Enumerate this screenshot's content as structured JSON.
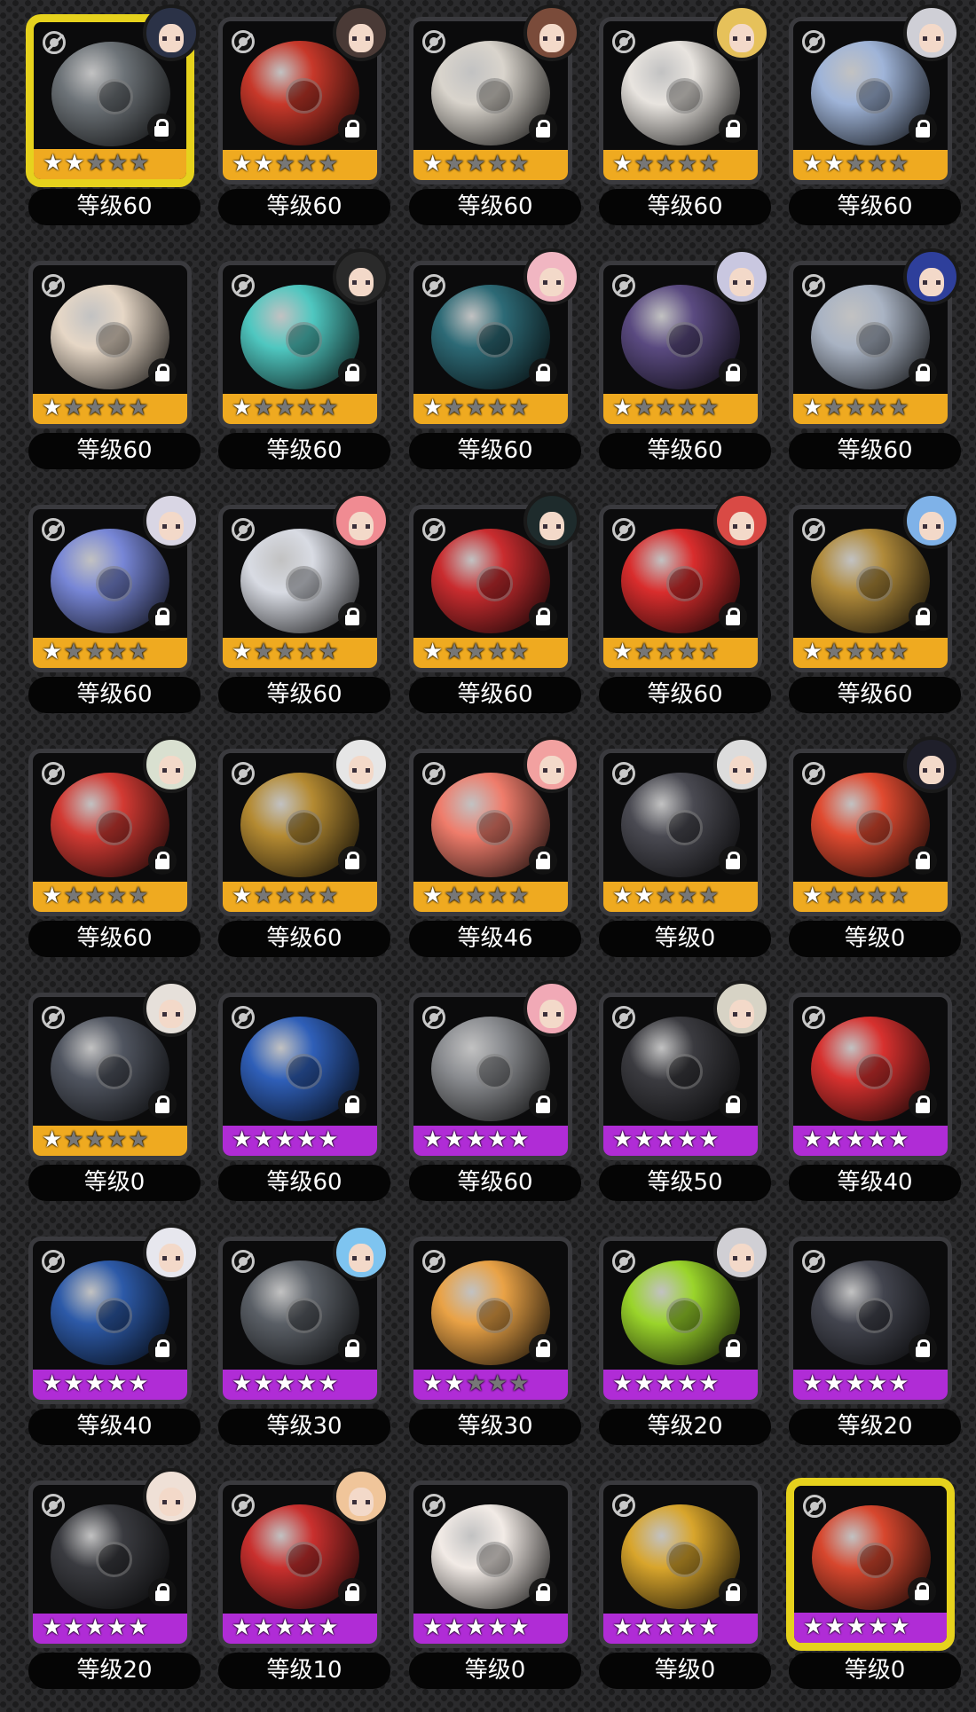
{
  "level_prefix": "等级",
  "colors": {
    "gold_bar": "#efaa20",
    "purple_bar": "#b02cd6",
    "selected_border": "#e6d21d",
    "card_border": "#3a3a3e",
    "level_pill": "#050505"
  },
  "icons": {
    "type": "type-icon",
    "lock": "lock-icon",
    "star": "star-icon"
  },
  "cards": [
    {
      "level": "等级60",
      "stars": 2,
      "rarity": "gold",
      "avatar": true,
      "selected": true,
      "color": "#6d7378",
      "avatar_color": "#2b3247"
    },
    {
      "level": "等级60",
      "stars": 2,
      "rarity": "gold",
      "avatar": true,
      "selected": false,
      "color": "#c7382a",
      "avatar_color": "#4a3a36"
    },
    {
      "level": "等级60",
      "stars": 1,
      "rarity": "gold",
      "avatar": true,
      "selected": false,
      "color": "#d9d4cc",
      "avatar_color": "#7a4b3a"
    },
    {
      "level": "等级60",
      "stars": 1,
      "rarity": "gold",
      "avatar": true,
      "selected": false,
      "color": "#e8e4df",
      "avatar_color": "#e6c15a"
    },
    {
      "level": "等级60",
      "stars": 2,
      "rarity": "gold",
      "avatar": true,
      "selected": false,
      "color": "#9fb4d8",
      "avatar_color": "#cfcfd6"
    },
    {
      "level": "等级60",
      "stars": 1,
      "rarity": "gold",
      "avatar": false,
      "selected": false,
      "color": "#e6d7c6",
      "avatar_color": "#000000"
    },
    {
      "level": "等级60",
      "stars": 1,
      "rarity": "gold",
      "avatar": true,
      "selected": false,
      "color": "#4fc7c0",
      "avatar_color": "#2a2a2a"
    },
    {
      "level": "等级60",
      "stars": 1,
      "rarity": "gold",
      "avatar": true,
      "selected": false,
      "color": "#2d6a76",
      "avatar_color": "#f1b6c2"
    },
    {
      "level": "等级60",
      "stars": 1,
      "rarity": "gold",
      "avatar": true,
      "selected": false,
      "color": "#5a4a80",
      "avatar_color": "#c9c7e0"
    },
    {
      "level": "等级60",
      "stars": 1,
      "rarity": "gold",
      "avatar": true,
      "selected": false,
      "color": "#a9b3c3",
      "avatar_color": "#2e3f9b"
    },
    {
      "level": "等级60",
      "stars": 1,
      "rarity": "gold",
      "avatar": true,
      "selected": false,
      "color": "#7786d6",
      "avatar_color": "#d9d6e4"
    },
    {
      "level": "等级60",
      "stars": 1,
      "rarity": "gold",
      "avatar": true,
      "selected": false,
      "color": "#d8dbe3",
      "avatar_color": "#f08b92"
    },
    {
      "level": "等级60",
      "stars": 1,
      "rarity": "gold",
      "avatar": true,
      "selected": false,
      "color": "#c92c2f",
      "avatar_color": "#1e2b2c"
    },
    {
      "level": "等级60",
      "stars": 1,
      "rarity": "gold",
      "avatar": true,
      "selected": false,
      "color": "#d92d2d",
      "avatar_color": "#d94a45"
    },
    {
      "level": "等级60",
      "stars": 1,
      "rarity": "gold",
      "avatar": true,
      "selected": false,
      "color": "#b08a3a",
      "avatar_color": "#7fb2e8"
    },
    {
      "level": "等级60",
      "stars": 1,
      "rarity": "gold",
      "avatar": true,
      "selected": false,
      "color": "#d23a33",
      "avatar_color": "#d9e0d0"
    },
    {
      "level": "等级60",
      "stars": 1,
      "rarity": "gold",
      "avatar": true,
      "selected": false,
      "color": "#b48a32",
      "avatar_color": "#e6e6e6"
    },
    {
      "level": "等级46",
      "stars": 1,
      "rarity": "gold",
      "avatar": true,
      "selected": false,
      "color": "#ef7c6b",
      "avatar_color": "#f2a1a0"
    },
    {
      "level": "等级0",
      "stars": 2,
      "rarity": "gold",
      "avatar": true,
      "selected": false,
      "color": "#4a4a52",
      "avatar_color": "#dcdcdc"
    },
    {
      "level": "等级0",
      "stars": 1,
      "rarity": "gold",
      "avatar": true,
      "selected": false,
      "color": "#e04a30",
      "avatar_color": "#1f1f2a"
    },
    {
      "level": "等级0",
      "stars": 1,
      "rarity": "gold",
      "avatar": true,
      "selected": false,
      "color": "#505560",
      "avatar_color": "#e6e0da"
    },
    {
      "level": "等级60",
      "stars": 5,
      "rarity": "purple",
      "avatar": false,
      "selected": false,
      "color": "#2f5fb8",
      "avatar_color": "#000000"
    },
    {
      "level": "等级60",
      "stars": 5,
      "rarity": "purple",
      "avatar": true,
      "selected": false,
      "color": "#8a8c90",
      "avatar_color": "#f1a9b6"
    },
    {
      "level": "等级50",
      "stars": 5,
      "rarity": "purple",
      "avatar": true,
      "selected": false,
      "color": "#3b3b40",
      "avatar_color": "#d7d3c5"
    },
    {
      "level": "等级40",
      "stars": 5,
      "rarity": "purple",
      "avatar": false,
      "selected": false,
      "color": "#d7312f",
      "avatar_color": "#000000"
    },
    {
      "level": "等级40",
      "stars": 5,
      "rarity": "purple",
      "avatar": true,
      "selected": false,
      "color": "#2d5aa8",
      "avatar_color": "#e7e7ee"
    },
    {
      "level": "等级30",
      "stars": 5,
      "rarity": "purple",
      "avatar": true,
      "selected": false,
      "color": "#5a5f66",
      "avatar_color": "#7ec4f0"
    },
    {
      "level": "等级30",
      "stars": 2,
      "rarity": "purple",
      "avatar": false,
      "selected": false,
      "color": "#e9a246",
      "avatar_color": "#000000"
    },
    {
      "level": "等级20",
      "stars": 5,
      "rarity": "purple",
      "avatar": true,
      "selected": false,
      "color": "#9ad42b",
      "avatar_color": "#d0cfd4"
    },
    {
      "level": "等级20",
      "stars": 5,
      "rarity": "purple",
      "avatar": false,
      "selected": false,
      "color": "#43454f",
      "avatar_color": "#000000"
    },
    {
      "level": "等级20",
      "stars": 5,
      "rarity": "purple",
      "avatar": true,
      "selected": false,
      "color": "#3a3b40",
      "avatar_color": "#efe0d6"
    },
    {
      "level": "等级10",
      "stars": 5,
      "rarity": "purple",
      "avatar": true,
      "selected": false,
      "color": "#c9302e",
      "avatar_color": "#f0c59a"
    },
    {
      "level": "等级0",
      "stars": 5,
      "rarity": "purple",
      "avatar": false,
      "selected": false,
      "color": "#f2ebe6",
      "avatar_color": "#000000"
    },
    {
      "level": "等级0",
      "stars": 5,
      "rarity": "purple",
      "avatar": false,
      "selected": false,
      "color": "#d8a52c",
      "avatar_color": "#000000"
    },
    {
      "level": "等级0",
      "stars": 5,
      "rarity": "purple",
      "avatar": false,
      "selected": true,
      "color": "#d7472e",
      "avatar_color": "#000000"
    }
  ]
}
